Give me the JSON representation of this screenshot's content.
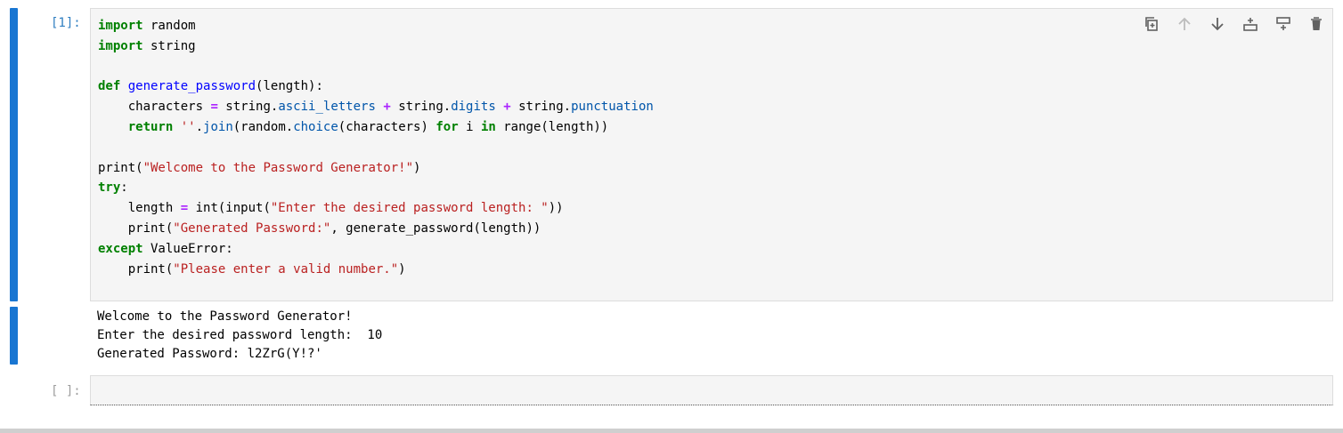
{
  "cell1": {
    "prompt": "[1]:",
    "code": {
      "l1_kw": "import",
      "l1_rest": " random",
      "l2_kw": "import",
      "l2_rest": " string",
      "l4_kw": "def",
      "l4_fn": "generate_password",
      "l4_rest": "(length):",
      "l5_a": "    characters ",
      "l5_op1": "=",
      "l5_b": " string.",
      "l5_attr1": "ascii_letters",
      "l5_op2": "+",
      "l5_c": " string.",
      "l5_attr2": "digits",
      "l5_op3": "+",
      "l5_d": " string.",
      "l5_attr3": "punctuation",
      "l6_a": "    ",
      "l6_kw": "return",
      "l6_str": "''",
      "l6_b": ".",
      "l6_attr1": "join",
      "l6_c": "(random.",
      "l6_attr2": "choice",
      "l6_d": "(characters) ",
      "l6_kw2": "for",
      "l6_e": " i ",
      "l6_kw3": "in",
      "l6_f": " range(length))",
      "l8_a": "print(",
      "l8_str": "\"Welcome to the Password Generator!\"",
      "l8_b": ")",
      "l9_kw": "try",
      "l9_b": ":",
      "l10_a": "    length ",
      "l10_op": "=",
      "l10_b": " int(input(",
      "l10_str": "\"Enter the desired password length: \"",
      "l10_c": "))",
      "l11_a": "    print(",
      "l11_str": "\"Generated Password:\"",
      "l11_b": ", generate_password(length))",
      "l12_kw": "except",
      "l12_b": " ValueError:",
      "l13_a": "    print(",
      "l13_str": "\"Please enter a valid number.\"",
      "l13_b": ")"
    },
    "toolbar": {
      "icons": [
        "duplicate-icon",
        "move-up-icon",
        "move-down-icon",
        "insert-above-icon",
        "insert-below-icon",
        "delete-icon"
      ]
    }
  },
  "output": {
    "lines": [
      "Welcome to the Password Generator!",
      "Enter the desired password length:  10",
      "Generated Password: l2ZrG(Y!?'"
    ]
  },
  "cell2": {
    "prompt": "[ ]:"
  },
  "colors": {
    "accent": "#1976d2",
    "keyword": "#008000",
    "string": "#ba2121",
    "operator": "#aa22ff",
    "function": "#0000ff",
    "attribute": "#0055aa"
  }
}
